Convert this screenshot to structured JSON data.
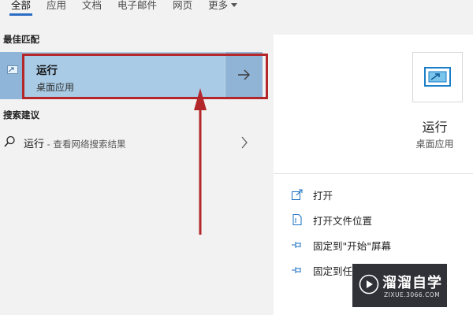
{
  "tabs": [
    {
      "label": "全部",
      "active": true
    },
    {
      "label": "应用"
    },
    {
      "label": "文档"
    },
    {
      "label": "电子邮件"
    },
    {
      "label": "网页"
    },
    {
      "label": "更多"
    }
  ],
  "best_match": {
    "section_title": "最佳匹配",
    "title": "运行",
    "subtitle": "桌面应用"
  },
  "suggestions": {
    "section_title": "搜索建议",
    "item_text": "运行",
    "item_hint": " - 查看网络搜索结果"
  },
  "preview": {
    "app_name": "运行",
    "app_type": "桌面应用",
    "actions": [
      {
        "label": "打开",
        "icon": "open-window-icon"
      },
      {
        "label": "打开文件位置",
        "icon": "file-location-icon"
      },
      {
        "label": "固定到\"开始\"屏幕",
        "icon": "pin-icon"
      },
      {
        "label": "固定到任",
        "icon": "pin-icon"
      }
    ]
  },
  "watermark": {
    "text": "溜溜自学",
    "url": "ZIXUE.3066.COM"
  },
  "colors": {
    "accent": "#2b6cc4",
    "selected_bg": "#a9cbe6",
    "annotation_red": "#b3272a"
  }
}
